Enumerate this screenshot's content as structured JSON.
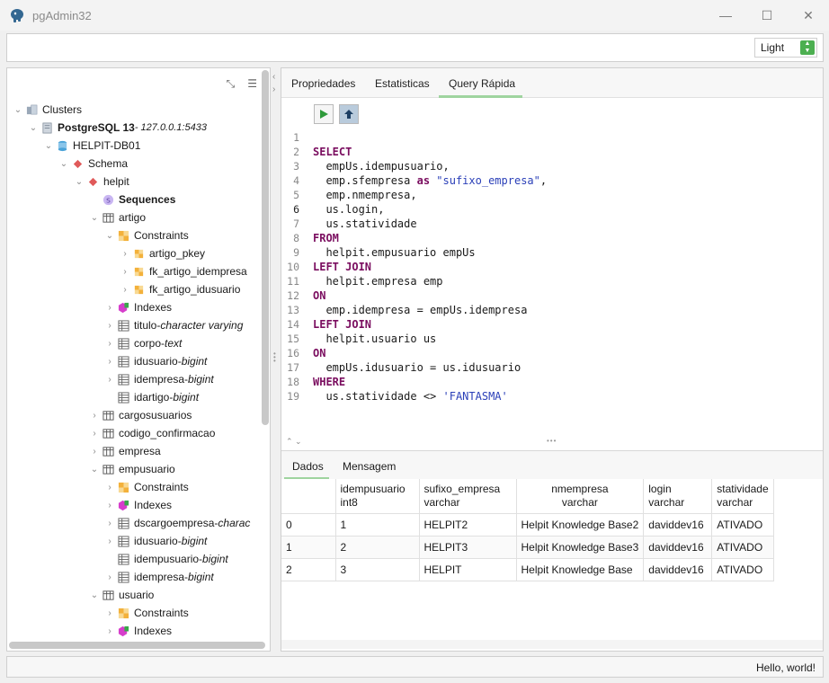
{
  "window": {
    "title": "pgAdmin32",
    "minimize": "—",
    "maximize": "☐",
    "close": "✕"
  },
  "toolbar": {
    "theme_value": "Light"
  },
  "tree": {
    "nodes": [
      {
        "label": "Clusters",
        "icon": "clusters-icon",
        "expanded": true
      },
      {
        "label": "PostgreSQL 13",
        "suffix": " - 127.0.0.1:5433",
        "icon": "server-icon",
        "expanded": true
      },
      {
        "label": "HELPIT-DB01",
        "icon": "database-icon",
        "expanded": true
      },
      {
        "label": "Schema",
        "icon": "schema-icon",
        "expanded": true
      },
      {
        "label": "helpit",
        "icon": "schema-icon",
        "expanded": true
      },
      {
        "label": "Sequences",
        "icon": "sequence-icon",
        "expanded": null
      },
      {
        "label": "artigo",
        "icon": "table-icon",
        "expanded": true
      },
      {
        "label": "Constraints",
        "icon": "constraints-icon",
        "expanded": true
      },
      {
        "label": "artigo_pkey",
        "icon": "constraint-icon",
        "expanded": false
      },
      {
        "label": "fk_artigo_idempresa",
        "icon": "constraint-icon",
        "expanded": false
      },
      {
        "label": "fk_artigo_idusuario",
        "icon": "constraint-icon",
        "expanded": false
      },
      {
        "label": "Indexes",
        "icon": "indexes-icon",
        "expanded": false
      },
      {
        "label": "titulo",
        "type": "character varying",
        "icon": "column-icon",
        "expanded": false
      },
      {
        "label": "corpo",
        "type": "text",
        "icon": "column-icon",
        "expanded": false
      },
      {
        "label": "idusuario",
        "type": "bigint",
        "icon": "column-icon",
        "expanded": false
      },
      {
        "label": "idempresa",
        "type": "bigint",
        "icon": "column-icon",
        "expanded": false
      },
      {
        "label": "idartigo",
        "type": "bigint",
        "icon": "column-icon",
        "expanded": null
      },
      {
        "label": "cargosusuarios",
        "icon": "table-icon",
        "expanded": false
      },
      {
        "label": "codigo_confirmacao",
        "icon": "table-icon",
        "expanded": false
      },
      {
        "label": "empresa",
        "icon": "table-icon",
        "expanded": false
      },
      {
        "label": "empusuario",
        "icon": "table-icon",
        "expanded": true
      },
      {
        "label": "Constraints",
        "icon": "constraints-icon",
        "expanded": false
      },
      {
        "label": "Indexes",
        "icon": "indexes-icon",
        "expanded": false
      },
      {
        "label": "dscargoempresa",
        "type": "charac",
        "icon": "column-icon",
        "expanded": false
      },
      {
        "label": "idusuario",
        "type": "bigint",
        "icon": "column-icon",
        "expanded": false
      },
      {
        "label": "idempusuario",
        "type": "bigint",
        "icon": "column-icon",
        "expanded": null
      },
      {
        "label": "idempresa",
        "type": "bigint",
        "icon": "column-icon",
        "expanded": false
      },
      {
        "label": "usuario",
        "icon": "table-icon",
        "expanded": true
      },
      {
        "label": "Constraints",
        "icon": "constraints-icon",
        "expanded": false
      },
      {
        "label": "Indexes",
        "icon": "indexes-icon",
        "expanded": false
      }
    ]
  },
  "tabs": [
    {
      "label": "Propriedades"
    },
    {
      "label": "Estatisticas"
    },
    {
      "label": "Query Rápida"
    }
  ],
  "editor": {
    "current_line": 6,
    "lines": [
      "",
      "SELECT",
      "  empUs.idempusuario,",
      "  emp.sfempresa as \"sufixo_empresa\",",
      "  emp.nmempresa,",
      "  us.login,",
      "  us.statividade",
      "FROM",
      "  helpit.empusuario empUs",
      "LEFT JOIN",
      "  helpit.empresa emp",
      "ON",
      "  emp.idempresa = empUs.idempresa",
      "LEFT JOIN",
      "  helpit.usuario us",
      "ON",
      "  empUs.idusuario = us.idusuario",
      "WHERE",
      "  us.statividade <> 'FANTASMA'"
    ]
  },
  "result_tabs": [
    {
      "label": "Dados"
    },
    {
      "label": "Mensagem"
    }
  ],
  "grid": {
    "columns": [
      {
        "name": "",
        "type": ""
      },
      {
        "name": "idempusuario",
        "type": "int8"
      },
      {
        "name": "sufixo_empresa",
        "type": "varchar"
      },
      {
        "name": "nmempresa",
        "type": "varchar"
      },
      {
        "name": "login",
        "type": "varchar"
      },
      {
        "name": "statividade",
        "type": "varchar"
      }
    ],
    "rows": [
      [
        "0",
        "1",
        "HELPIT2",
        "Helpit Knowledge Base2",
        "daviddev16",
        "ATIVADO"
      ],
      [
        "1",
        "2",
        "HELPIT3",
        "Helpit Knowledge Base3",
        "daviddev16",
        "ATIVADO"
      ],
      [
        "2",
        "3",
        "HELPIT",
        "Helpit Knowledge Base",
        "daviddev16",
        "ATIVADO"
      ]
    ]
  },
  "status": {
    "text": "Hello, world!"
  }
}
